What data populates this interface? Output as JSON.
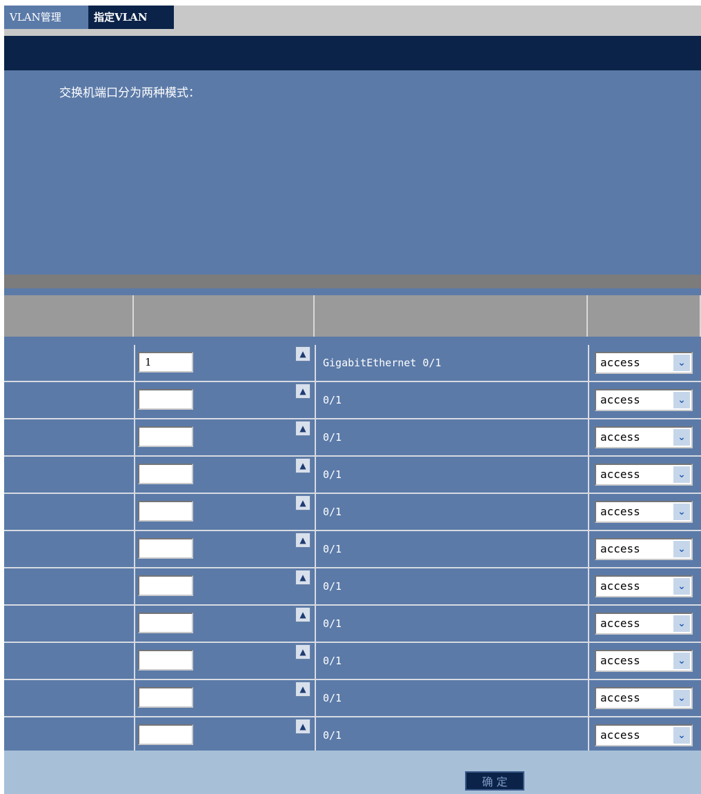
{
  "tabs": [
    {
      "label": "VLAN管理"
    },
    {
      "label": "指定VLAN"
    }
  ],
  "description": {
    "title": "交换机端口分为两种模式："
  },
  "table": {
    "rows": [
      {
        "vlan_value": "1",
        "port": "GigabitEthernet 0/1",
        "type": "access"
      },
      {
        "vlan_value": "",
        "port": "0/1",
        "type": "access"
      },
      {
        "vlan_value": "",
        "port": "0/1",
        "type": "access"
      },
      {
        "vlan_value": "",
        "port": "0/1",
        "type": "access"
      },
      {
        "vlan_value": "",
        "port": "0/1",
        "type": "access"
      },
      {
        "vlan_value": "",
        "port": "0/1",
        "type": "access"
      },
      {
        "vlan_value": "",
        "port": "0/1",
        "type": "access"
      },
      {
        "vlan_value": "",
        "port": "0/1",
        "type": "access"
      },
      {
        "vlan_value": "",
        "port": "0/1",
        "type": "access"
      },
      {
        "vlan_value": "",
        "port": "0/1",
        "type": "access"
      },
      {
        "vlan_value": "",
        "port": "0/1",
        "type": "access"
      }
    ]
  },
  "footer": {
    "confirm_label": "确 定"
  },
  "colors": {
    "panel": "#5b7aa8",
    "navy": "#0b2348"
  }
}
